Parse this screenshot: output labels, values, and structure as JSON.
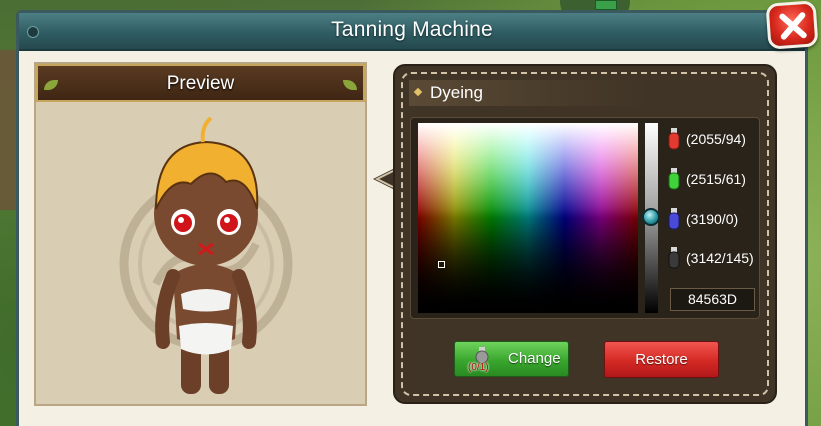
{
  "window": {
    "title": "Tanning Machine"
  },
  "preview": {
    "title": "Preview"
  },
  "dyeing": {
    "title": "Dyeing",
    "hex_value": "84563D",
    "potions": [
      {
        "color": "red",
        "icon": "red-potion-icon",
        "text": "(2055/94)"
      },
      {
        "color": "green",
        "icon": "green-potion-icon",
        "text": "(2515/61)"
      },
      {
        "color": "blue",
        "icon": "blue-potion-icon",
        "text": "(3190/0)"
      },
      {
        "color": "black",
        "icon": "black-potion-icon",
        "text": "(3142/145)"
      }
    ]
  },
  "buttons": {
    "change_label": "Change",
    "change_count": "(0/1)",
    "restore_label": "Restore"
  },
  "colors": {
    "title_bar": "#2f5d63",
    "panel_dark": "#3f3426",
    "change_green": "#39a62e",
    "restore_red": "#d42923",
    "close_red": "#d8291d"
  }
}
